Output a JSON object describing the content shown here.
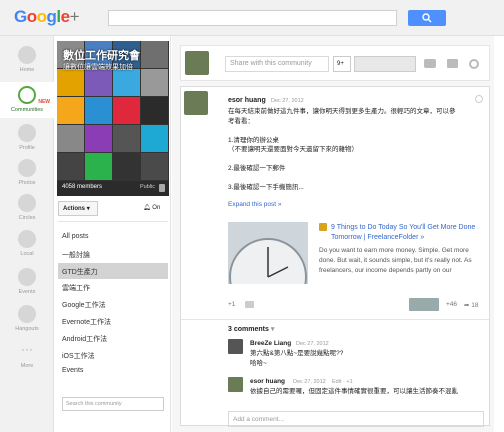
{
  "header": {
    "logo_text": "Google",
    "logo_plus": "+",
    "search_placeholder": ""
  },
  "left_nav": [
    {
      "label": "Home"
    },
    {
      "label": "Communities",
      "badge": "NEW",
      "active": true
    },
    {
      "label": "Profile"
    },
    {
      "label": "Photos"
    },
    {
      "label": "Circles"
    },
    {
      "label": "Local"
    },
    {
      "label": "Events"
    },
    {
      "label": "Hangouts"
    },
    {
      "label": "More"
    }
  ],
  "community": {
    "title": "數位工作研究會",
    "subtitle": "讓數位讓雲端效果加倍",
    "members": "4058 members",
    "visibility": "Public",
    "actions_label": "Actions",
    "notify_label": "On",
    "categories": [
      "All posts",
      "一般討論",
      "GTD生產力",
      "雲端工作",
      "Google工作法",
      "Evernote工作法",
      "Android工作法",
      "iOS工作法",
      "Events"
    ],
    "selected_category": "GTD生產力",
    "search_placeholder": "Search this community"
  },
  "share_box": {
    "placeholder": "Share with this community",
    "count": "9+"
  },
  "post": {
    "author": "esor huang",
    "date": "Dec 27, 2012",
    "text_lines": [
      "在每天結束前做好這九件事，讓你明天得到更多生產力。很輕巧的文章，可以參",
      "考看看：",
      "",
      "1.清理你的辦公桌",
      "（不要讓明天還要面對今天遺留下來的雜物）",
      "",
      "2.最後確認一下郵件",
      "",
      "3.最後確認一下手機簡訊..."
    ],
    "expand": "Expand this post »",
    "link_title": "9 Things to Do Today So You'll Get More Done Tomorrow | FreelanceFolder »",
    "link_desc": "Do you want to earn more money. Simple. Get more done. But wait, it sounds simple, but it's really not. As freelancers, our income depends partly on our",
    "plus_one": "+1",
    "plus_count": "+46",
    "share_count": "18",
    "comments_header": "3 comments",
    "comments": [
      {
        "author": "BreeZe Liang",
        "date": "Dec 27, 2012",
        "extra": "",
        "text_lines": [
          "第六點&第八點~是要說幾點呢??",
          "哈哈~"
        ]
      },
      {
        "author": "esor huang",
        "date": "Dec 27, 2012",
        "extra": "Edit · +1",
        "text_lines": [
          "依據自己的需要囉，但固定這件事情確實很重要，可以讓生活節奏不混亂"
        ]
      }
    ],
    "add_comment_placeholder": "Add a comment..."
  },
  "colors": {
    "accent_blue": "#4d90fe",
    "communities_green": "#53a93f",
    "new_badge": "#dd4b39"
  }
}
